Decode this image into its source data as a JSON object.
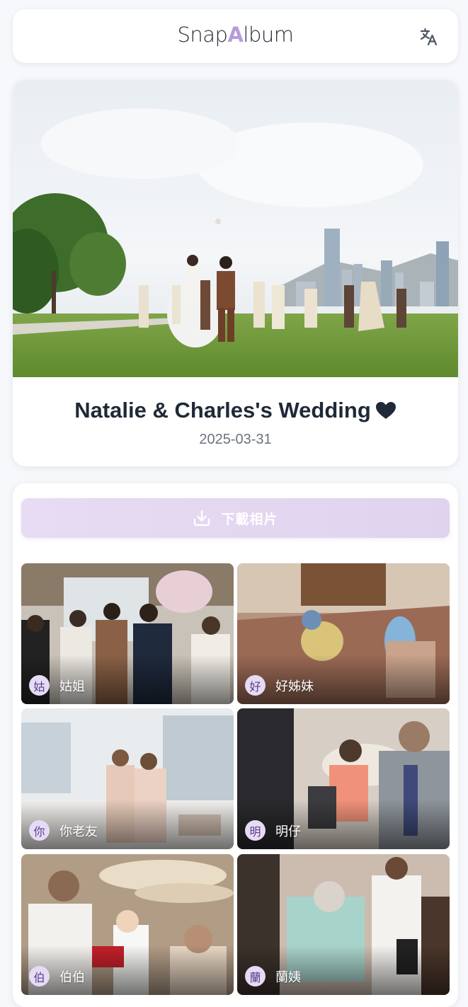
{
  "header": {
    "logo_prefix": "Snap",
    "logo_accent": "A",
    "logo_suffix": "lbum",
    "translate_icon": "translate-icon"
  },
  "hero": {
    "title": "Natalie & Charles's Wedding",
    "date": "2025-03-31",
    "heart_icon": "heart-icon"
  },
  "gallery": {
    "download_label": "下載相片",
    "download_icon": "download-icon",
    "tiles": [
      {
        "avatar": "姑",
        "name": "姑姐"
      },
      {
        "avatar": "好",
        "name": "好姊妹"
      },
      {
        "avatar": "你",
        "name": "你老友"
      },
      {
        "avatar": "明",
        "name": "明仔"
      },
      {
        "avatar": "伯",
        "name": "伯伯"
      },
      {
        "avatar": "蘭",
        "name": "蘭姨"
      }
    ]
  },
  "colors": {
    "accent": "#b79ddb",
    "download_button": "#e3d7f1",
    "avatar_bg": "#e6dbf5",
    "page_bg": "#f6f8fb"
  }
}
